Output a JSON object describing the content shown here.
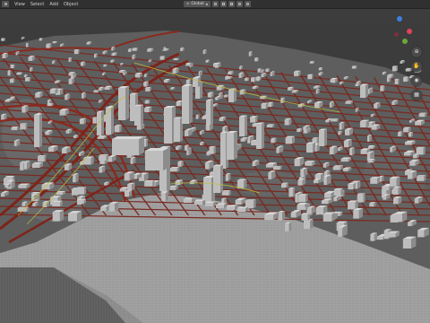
{
  "header": {
    "menus": [
      {
        "label": "View",
        "name": "menu-view"
      },
      {
        "label": "Select",
        "name": "menu-select"
      },
      {
        "label": "Add",
        "name": "menu-add"
      },
      {
        "label": "Object",
        "name": "menu-object"
      }
    ],
    "orientation_value": "Global"
  },
  "gizmo": {
    "x_label": "X",
    "y_label": "Y",
    "z_label": "Z",
    "colors": {
      "x": "#e0435a",
      "y": "#6ea63a",
      "z": "#3c7fe0"
    }
  },
  "nav_buttons": [
    {
      "name": "zoom-icon",
      "glyph": "⊕"
    },
    {
      "name": "pan-hand-icon",
      "glyph": "✋"
    },
    {
      "name": "camera-icon",
      "glyph": "◉"
    },
    {
      "name": "perspective-grid-icon",
      "glyph": "▦"
    }
  ],
  "scene": {
    "description_colors": {
      "road": "#7a2a20",
      "building": "#d8d8d8",
      "terrain": "#5c5c5c",
      "water": "#9a9a9a",
      "highlight_road": "#c6c43c"
    }
  }
}
